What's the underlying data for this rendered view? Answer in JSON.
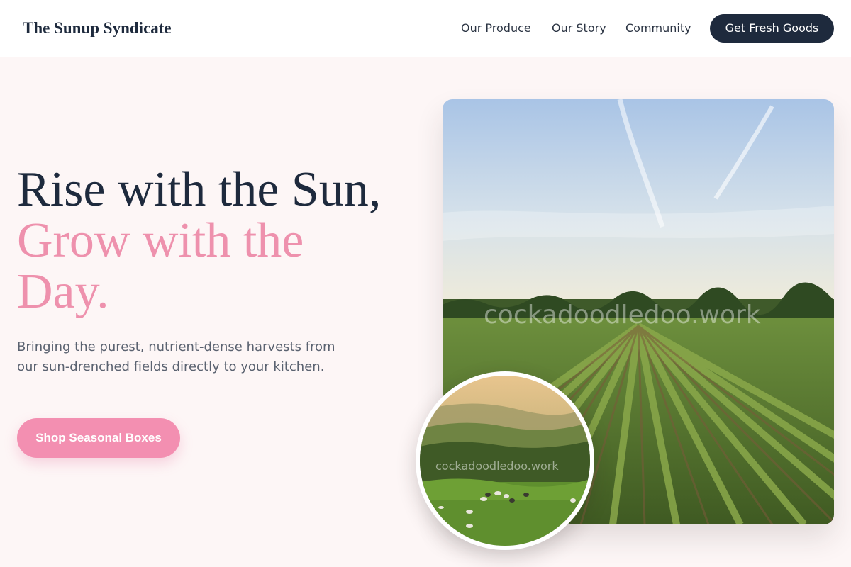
{
  "header": {
    "brand": "The Sunup Syndicate",
    "nav": [
      "Our Produce",
      "Our Story",
      "Community"
    ],
    "cta_label": "Get Fresh Goods"
  },
  "hero": {
    "title_line1": "Rise with the Sun,",
    "title_line2": "Grow with the Day.",
    "subtitle": "Bringing the purest, nutrient-dense harvests from our sun-drenched fields directly to your kitchen.",
    "button_label": "Shop Seasonal Boxes"
  },
  "images": {
    "main_watermark": "cockadoodledoo.work",
    "inset_watermark": "cockadoodledoo.work"
  },
  "colors": {
    "navy": "#1e2a3d",
    "pink_accent": "#ee91ad",
    "button_pink": "#f38fb1",
    "background": "#fdf6f6"
  }
}
